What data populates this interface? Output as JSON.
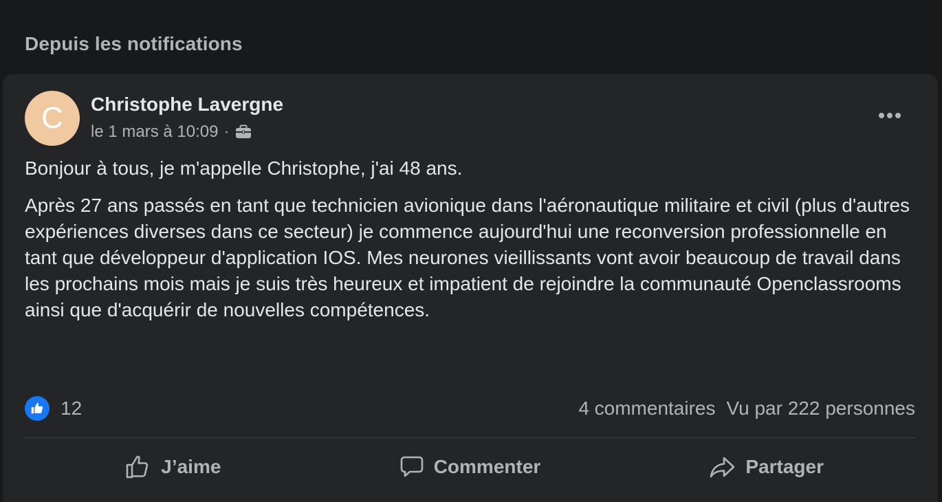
{
  "section": {
    "title": "Depuis les notifications"
  },
  "post": {
    "avatar_letter": "C",
    "avatar_color": "#f0c9a0",
    "author": "Christophe Lavergne",
    "timestamp": "le 1 mars à 10:09",
    "separator": "·",
    "audience_icon": "briefcase-icon",
    "paragraphs": [
      "Bonjour à tous, je m'appelle Christophe, j'ai 48 ans.",
      "Après 27 ans passés en tant que technicien avionique dans l'aéronautique militaire et civil (plus d'autres expériences diverses dans ce secteur) je commence aujourd'hui une reconversion professionnelle en tant que développeur d'application IOS. Mes neurones vieillissants vont avoir beaucoup de travail dans les prochains mois mais je suis très heureux et impatient de rejoindre la communauté Openclassrooms ainsi que d'acquérir de nouvelles compétences."
    ]
  },
  "stats": {
    "reactions_count": "12",
    "comments": "4 commentaires",
    "views": "Vu par 222 personnes"
  },
  "actions": {
    "like": "J’aime",
    "comment": "Commenter",
    "share": "Partager"
  },
  "colors": {
    "background": "#18191a",
    "card": "#242526",
    "accent": "#1877f2",
    "text_primary": "#e4e6eb",
    "text_secondary": "#b0b3b8"
  }
}
